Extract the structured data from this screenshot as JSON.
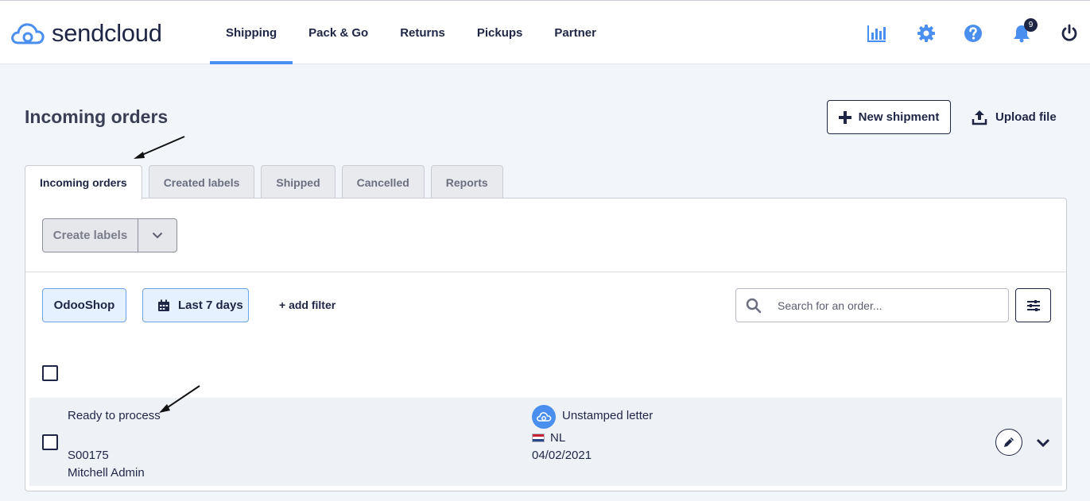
{
  "brand": {
    "name": "sendcloud",
    "accent": "#4a8ef0",
    "navy": "#1f2545"
  },
  "nav": {
    "items": [
      {
        "label": "Shipping",
        "active": true
      },
      {
        "label": "Pack & Go",
        "active": false
      },
      {
        "label": "Returns",
        "active": false
      },
      {
        "label": "Pickups",
        "active": false
      },
      {
        "label": "Partner",
        "active": false
      }
    ],
    "icons": [
      "analytics-icon",
      "settings-gear-icon",
      "help-icon",
      "notifications-bell-icon",
      "power-icon"
    ],
    "notification_count": "9"
  },
  "page": {
    "title": "Incoming orders",
    "new_shipment_label": "New shipment",
    "upload_file_label": "Upload file"
  },
  "tabs": [
    {
      "label": "Incoming orders",
      "active": true
    },
    {
      "label": "Created labels",
      "active": false
    },
    {
      "label": "Shipped",
      "active": false
    },
    {
      "label": "Cancelled",
      "active": false
    },
    {
      "label": "Reports",
      "active": false
    }
  ],
  "toolbar": {
    "create_labels_label": "Create labels"
  },
  "filters": {
    "shop_chip": "OdooShop",
    "date_chip": "Last 7 days",
    "add_filter": "+ add filter",
    "search_placeholder": "Search for an order..."
  },
  "order": {
    "status": "Ready to process",
    "order_number": "S00175",
    "customer": "Mitchell Admin",
    "shipping_method": "Unstamped letter",
    "country": "NL",
    "date": "04/02/2021"
  }
}
